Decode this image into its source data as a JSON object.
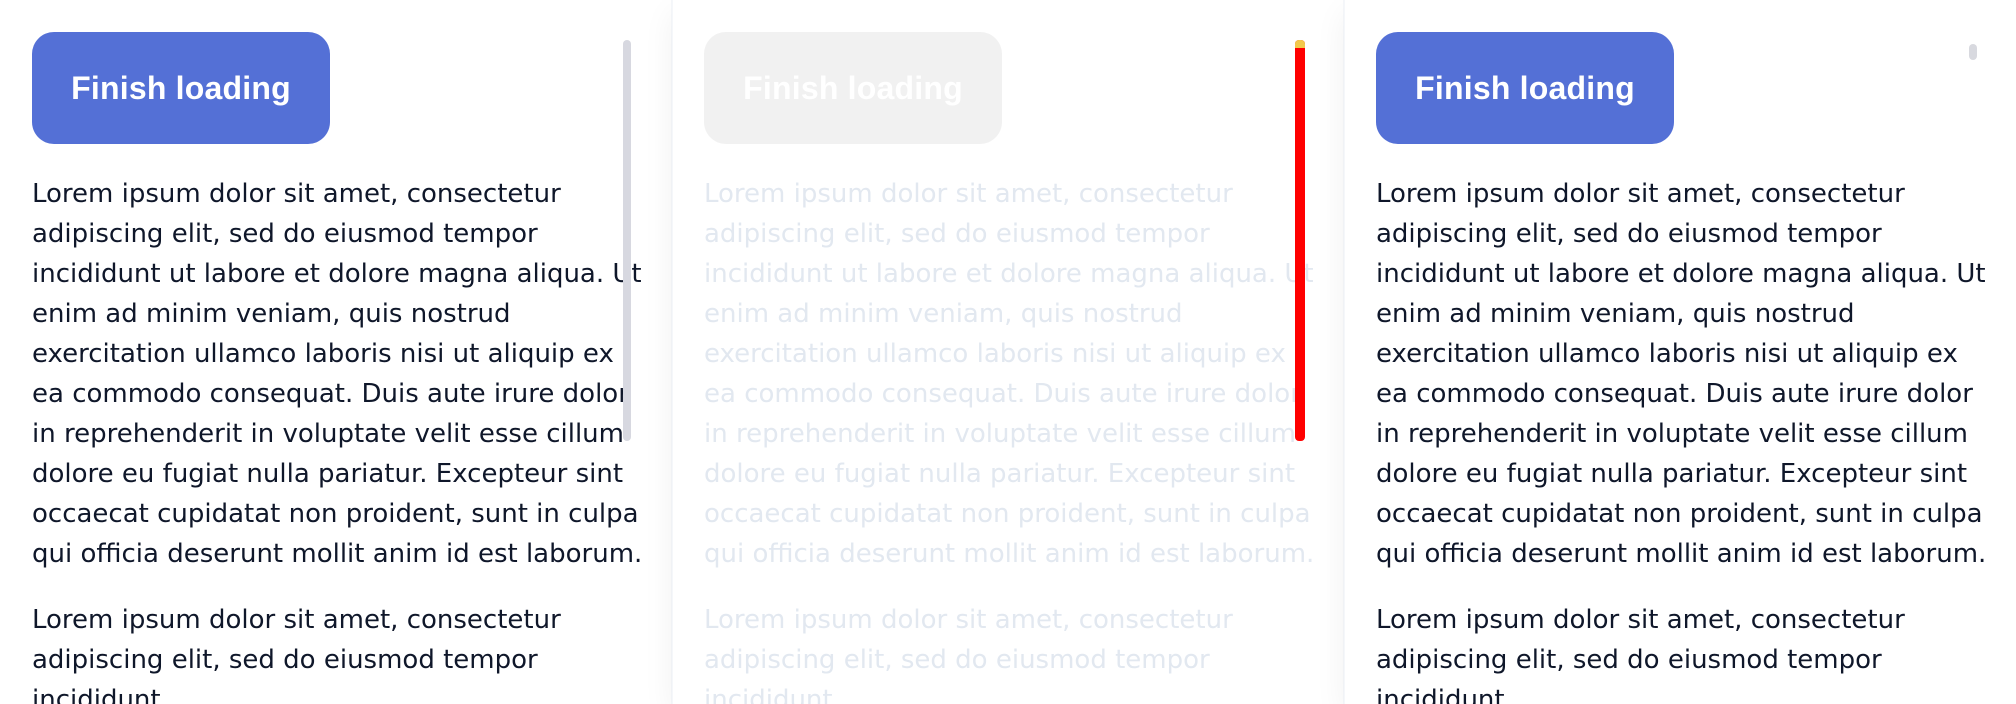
{
  "panels": [
    {
      "id": "left",
      "button_label": "Finish loading",
      "paragraphs": [
        "Lorem ipsum dolor sit amet, consectetur adipiscing elit, sed do eiusmod tempor incididunt ut labore et dolore magna aliqua. Ut enim ad minim veniam, quis nostrud exercitation ullamco laboris nisi ut aliquip ex ea commodo consequat. Duis aute irure dolor in reprehenderit in voluptate velit esse cillum dolore eu fugiat nulla pariatur. Excepteur sint occaecat cupidatat non proident, sunt in culpa qui officia deserunt mollit anim id est laborum.",
        "Lorem ipsum dolor sit amet, consectetur adipiscing elit, sed do eiusmod tempor incididunt"
      ]
    },
    {
      "id": "middle",
      "button_label": "Finish loading",
      "paragraphs": [
        "Lorem ipsum dolor sit amet, consectetur adipiscing elit, sed do eiusmod tempor incididunt ut labore et dolore magna aliqua. Ut enim ad minim veniam, quis nostrud exercitation ullamco laboris nisi ut aliquip ex ea commodo consequat. Duis aute irure dolor in reprehenderit in voluptate velit esse cillum dolore eu fugiat nulla pariatur. Excepteur sint occaecat cupidatat non proident, sunt in culpa qui officia deserunt mollit anim id est laborum.",
        "Lorem ipsum dolor sit amet, consectetur adipiscing elit, sed do eiusmod tempor incididunt"
      ]
    },
    {
      "id": "right",
      "button_label": "Finish loading",
      "paragraphs": [
        "Lorem ipsum dolor sit amet, consectetur adipiscing elit, sed do eiusmod tempor incididunt ut labore et dolore magna aliqua. Ut enim ad minim veniam, quis nostrud exercitation ullamco laboris nisi ut aliquip ex ea commodo consequat. Duis aute irure dolor in reprehenderit in voluptate velit esse cillum dolore eu fugiat nulla pariatur. Excepteur sint occaecat cupidatat non proident, sunt in culpa qui officia deserunt mollit anim id est laborum.",
        "Lorem ipsum dolor sit amet, consectetur adipiscing elit, sed do eiusmod tempor incididunt"
      ]
    }
  ],
  "colors": {
    "button_active": "#5470d6",
    "button_muted": "#f1f1f1",
    "text": "#0f172a",
    "muted_text": "#e2e8f0",
    "scrollbar": "#d7d8e0",
    "red_scrollbar": "#ff0000"
  }
}
